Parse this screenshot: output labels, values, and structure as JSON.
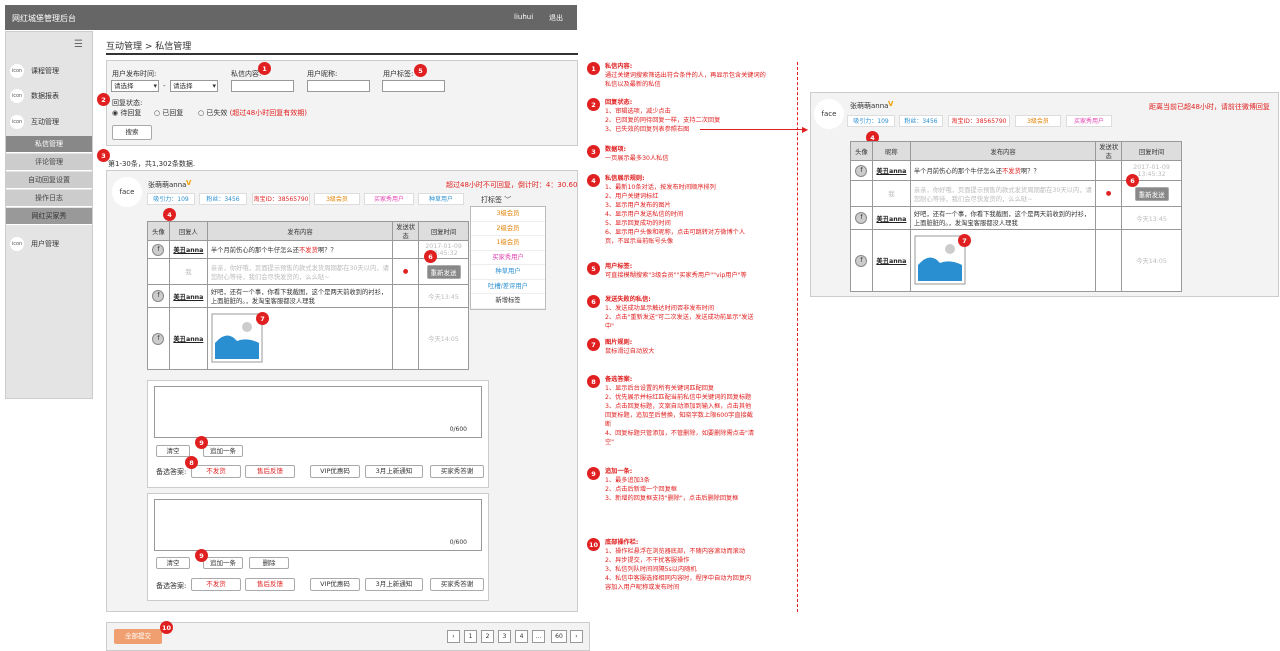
{
  "app_title": "网红城堡管理后台",
  "user": "liuhui",
  "logout": "退出",
  "menu_icon": "list-icon",
  "sidebar": {
    "items": [
      {
        "icon": "icon",
        "label": "课程管理"
      },
      {
        "icon": "icon",
        "label": "数据报表"
      },
      {
        "icon": "icon",
        "label": "互动管理"
      }
    ],
    "subitems": [
      "私信管理",
      "评论管理",
      "自动回复设置",
      "操作日志",
      "网红买家秀"
    ],
    "bottom": {
      "icon": "icon",
      "label": "用户管理"
    }
  },
  "breadcrumb": "互动管理 > 私信管理",
  "filters": {
    "time_label": "用户发布时间:",
    "time_from": "请选择",
    "time_sep": "-",
    "time_to": "请选择",
    "content_label": "私信内容:",
    "nickname_label": "用户昵称:",
    "tag_label": "用户标签:",
    "reply_label": "回复状态:",
    "radios": [
      "待回复",
      "已回复",
      "已失效"
    ],
    "expired_note": "(超过48小时回复有效期)",
    "search": "搜索"
  },
  "summary": "第1-30条，共1,302条数据.",
  "card": {
    "avatar": "face",
    "name": "张萌萌anna",
    "verified_icon": "v-icon",
    "countdown": "超过48小时不可回复，倒计时：4：30.60",
    "tags": [
      "吸引力：109",
      "粉丝：3456",
      "淘宝ID：38565790",
      "3级会员",
      "买家秀用户",
      "种草用户"
    ],
    "tag_button": "打标签"
  },
  "tag_dropdown": [
    "3级会员",
    "2级会员",
    "1级会员",
    "买家秀用户",
    "种草用户",
    "吐槽/差评用户",
    "新增标签"
  ],
  "table": {
    "headers": [
      "头像",
      "回复人",
      "发布内容",
      "发送状态",
      "回复时间"
    ],
    "rows": [
      {
        "av": "f",
        "name": "美丑anna",
        "pre": "半个月前伤心的那个牛仔怎么还",
        "hl": "不发货",
        "post": "啊？？",
        "time": "2017-01-09 13:45:32"
      },
      {
        "name": "我",
        "text": "亲亲，你好哦，页面提示预售的款式发货周期都在30天以内，请您耐心等待，我们会尽快发货的，么么哒~",
        "action": "重新发送"
      },
      {
        "av": "f",
        "name": "美丑anna",
        "text": "好吧，还有一个事，你看下我截图，这个是两天前收到的衬衫，上面脏脏的。，发淘宝客服都没人理我",
        "time": "今天13:45"
      },
      {
        "av": "f",
        "name": "美丑anna",
        "image": "image-placeholder",
        "time": "今天14:05"
      }
    ]
  },
  "reply_boxes": [
    {
      "count": "0/600",
      "clear": "清空",
      "add": "追加一条",
      "answers_label": "备选答案:",
      "answers": [
        "不发货",
        "售后反馈",
        "VIP优惠码",
        "3月上新通知",
        "买家秀答谢"
      ]
    },
    {
      "count": "0/600",
      "clear": "清空",
      "add": "追加一条",
      "delete": "删除",
      "answers_label": "备选答案:",
      "answers": [
        "不发货",
        "售后反馈",
        "VIP优惠码",
        "3月上新通知",
        "买家秀答谢"
      ]
    }
  ],
  "submit": "全部提交",
  "pagination": [
    "1",
    "2",
    "3",
    "4",
    "...",
    "60"
  ],
  "badges": [
    "1",
    "2",
    "3",
    "4",
    "5",
    "6",
    "7",
    "8",
    "9",
    "10"
  ],
  "annotations": [
    {
      "n": "1",
      "title": "私信内容:",
      "body": "通过关键词搜索筛选出符合条件的人，再显示包含关键词的\n私信以及最新的私信"
    },
    {
      "n": "2",
      "title": "回复状态:",
      "body": "1、审辑选项，减少点击\n2、已回复的同待回复一样，支持二次回复\n3、已失效的回复列表参照右图"
    },
    {
      "n": "3",
      "title": "数据项:",
      "body": "一页展示最多30人私信"
    },
    {
      "n": "4",
      "title": "私信展示规则:",
      "body": "1、最新10条对话，按发布时间顺序排列\n2、用户关键词标红\n3、显示用户发布的图片\n4、显示用户发送私信的时间\n5、显示回复成功的时间\n6、显示用户头像和昵称，点击可跳转对方微博个人\n页，不显示当前账号头像"
    },
    {
      "n": "5",
      "title": "用户标签:",
      "body": "可直接模糊搜索\"3级会员\"\"买家秀用户\"\"vip用户\"等"
    },
    {
      "n": "6",
      "title": "发送失败的私信:",
      "body": "1、发送成功显示触达时间否非发布时间\n2、点击\"重新发送\"可二次发送，发送成功前显示\"发送\n中\""
    },
    {
      "n": "7",
      "title": "图片规则:",
      "body": "鼠标滑过自动放大"
    },
    {
      "n": "8",
      "title": "备选答案:",
      "body": "1、显示后台设置的所有关键词匹配回复\n2、优先展示并标红匹配当前私信中关键词的回复标题\n3、点击回复标题，文案自动添加到输入框，点击其他\n回复标题，追加至后替换，知晓字数上限600字直接截\n断\n4、回复标题只管添加，不管删除，如要删除需点击\"清\n空\""
    },
    {
      "n": "9",
      "title": "追加一条:",
      "body": "1、最多追加3条\n2、点击后新增一个回复框\n3、新增的回复框支持\"删除\"，点击后删除回复框"
    },
    {
      "n": "10",
      "title": "底部操作栏:",
      "body": "1、操作栏悬浮在浏览器底部，不随内容滚动而滚动\n2、异步提交，不干扰客服操作\n3、私信列队时间间隔5s以内随机\n4、私信中客服选择相同内容时，程序中自动为回复内\n容加入用户昵称或发布时间"
    }
  ],
  "right_panel": {
    "avatar": "face",
    "name": "张萌萌anna",
    "note": "距离当前已超48小时，请前往微博回复",
    "tags": [
      "吸引力：109",
      "粉丝：3456",
      "淘宝ID：38565790",
      "3级会员",
      "买家秀用户"
    ],
    "headers": [
      "头像",
      "昵称",
      "发布内容",
      "发送状态",
      "回复时间"
    ],
    "rows": [
      {
        "av": "f",
        "name": "美丑anna",
        "pre": "半个月前伤心的那个牛仔怎么还",
        "hl": "不发货",
        "post": "啊？？",
        "time": "2017-01-09 13:45:32"
      },
      {
        "name": "我",
        "text": "亲亲，你好哦，页面提示预售的款式发货周期都在30天以内，请您耐心等待，我们会尽快发货的，么么哒~",
        "action": "重新发送"
      },
      {
        "av": "f",
        "name": "美丑anna",
        "text": "好吧，还有一个事，你看下我截图，这个是两天前收到的衬衫，上面脏脏的。，发淘宝客服都没人理我",
        "time": "今天13:45"
      },
      {
        "av": "f",
        "name": "美丑anna",
        "time": "今天14:05"
      }
    ]
  },
  "colors": {
    "accent_red": "#e02020",
    "submit_orange": "#f0a070",
    "image_blue": "#2a8fd0"
  }
}
